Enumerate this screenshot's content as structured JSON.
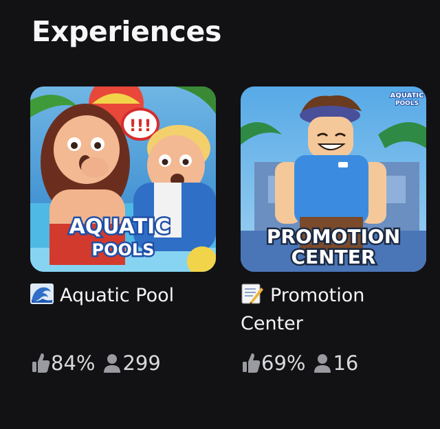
{
  "section": {
    "title": "Experiences"
  },
  "experiences": [
    {
      "emoji": "wave-emoji",
      "name": "Aquatic Pool",
      "thumbnail_logo": [
        "AQUATIC",
        "POOLS"
      ],
      "rating": "84%",
      "players": "299"
    },
    {
      "emoji": "memo-emoji",
      "name": "Promotion Center",
      "thumbnail_logo": [
        "PROMOTION",
        "CENTER"
      ],
      "thumbnail_corner_logo": [
        "AQUATIC",
        "POOLS"
      ],
      "rating": "69%",
      "players": "16"
    }
  ],
  "icons": {
    "rating": "thumbs-up-icon",
    "players": "person-icon"
  },
  "colors": {
    "background": "#121214",
    "text": "#f4f5f7",
    "stat_text": "#d9dadd",
    "icon": "#9a9ba0"
  }
}
